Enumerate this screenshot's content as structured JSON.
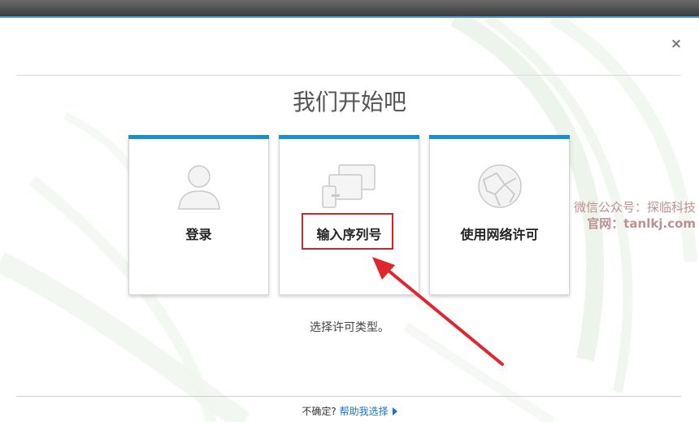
{
  "dialog": {
    "title": "我们开始吧",
    "close_label": "×",
    "subtitle": "选择许可类型。",
    "footer": {
      "question": "不确定?",
      "help_link": "帮助我选择"
    }
  },
  "cards": [
    {
      "label": "登录",
      "icon": "user-icon"
    },
    {
      "label": "输入序列号",
      "icon": "devices-icon"
    },
    {
      "label": "使用网络许可",
      "icon": "network-globe-icon"
    }
  ],
  "watermark": {
    "line1": "微信公众号：探临科技",
    "line2": "官网：tanlkj.com"
  },
  "colors": {
    "accent": "#1a8ed1",
    "highlight": "#c9282d",
    "link": "#1a73c7"
  }
}
